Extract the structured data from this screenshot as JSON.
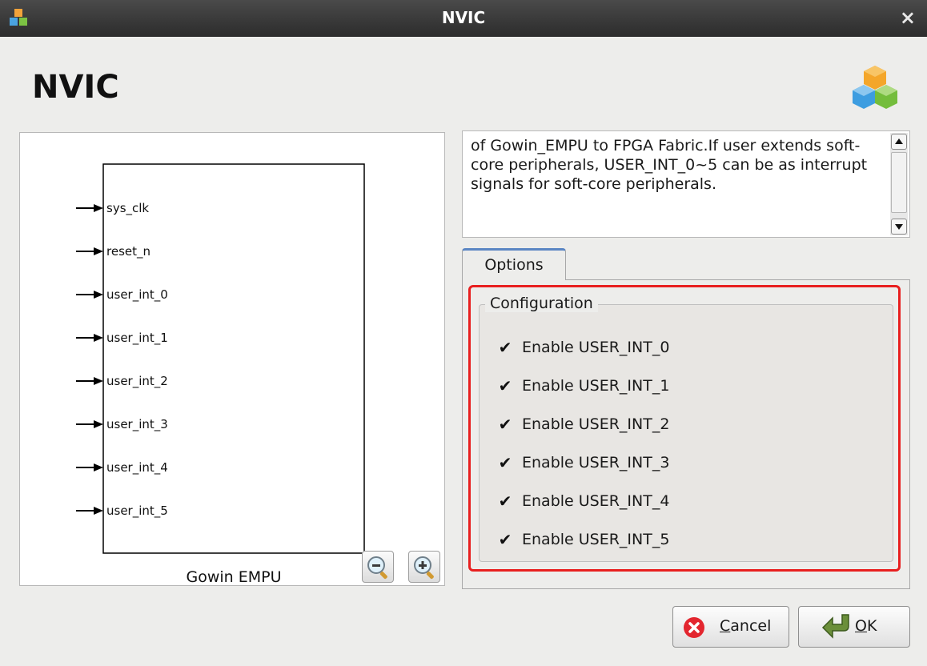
{
  "window": {
    "title": "NVIC"
  },
  "dialog": {
    "heading": "NVIC"
  },
  "diagram": {
    "block_name": "Gowin EMPU",
    "ports": [
      "sys_clk",
      "reset_n",
      "user_int_0",
      "user_int_1",
      "user_int_2",
      "user_int_3",
      "user_int_4",
      "user_int_5"
    ]
  },
  "description": {
    "text": "of Gowin_EMPU to FPGA Fabric.If user extends soft-core peripherals, USER_INT_0~5 can be as interrupt signals for soft-core peripherals."
  },
  "tabs": [
    {
      "label": "Options",
      "selected": true
    }
  ],
  "configuration": {
    "title": "Configuration",
    "checkboxes": [
      {
        "label": "Enable USER_INT_0",
        "checked": true
      },
      {
        "label": "Enable USER_INT_1",
        "checked": true
      },
      {
        "label": "Enable USER_INT_2",
        "checked": true
      },
      {
        "label": "Enable USER_INT_3",
        "checked": true
      },
      {
        "label": "Enable USER_INT_4",
        "checked": true
      },
      {
        "label": "Enable USER_INT_5",
        "checked": true
      }
    ]
  },
  "buttons": {
    "cancel": {
      "mnemonic": "C",
      "rest": "ancel"
    },
    "ok": {
      "mnemonic": "O",
      "rest": "K"
    }
  },
  "colors": {
    "highlight": "#e81f1f",
    "tab_accent": "#5b86c4"
  }
}
